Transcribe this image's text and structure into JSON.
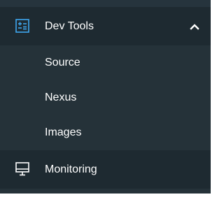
{
  "sidebar": {
    "dev_tools": {
      "label": "Dev Tools",
      "icon": "dev-tools-icon",
      "expanded": true,
      "children": [
        {
          "label": "Source"
        },
        {
          "label": "Nexus"
        },
        {
          "label": "Images"
        }
      ]
    },
    "monitoring": {
      "label": "Monitoring",
      "icon": "monitor-icon"
    }
  },
  "colors": {
    "background": "#1e2a31",
    "submenu_background": "#253239",
    "accent_icon": "#3ea7f0",
    "text": "#ffffff"
  }
}
